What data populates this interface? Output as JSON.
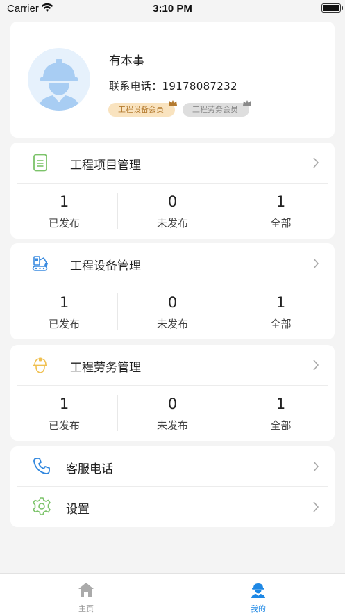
{
  "status_bar": {
    "carrier": "Carrier",
    "time": "3:10 PM"
  },
  "profile": {
    "name": "有本事",
    "phone_label": "联系电话：",
    "phone": "19178087232",
    "badges": [
      "工程设备会员",
      "工程劳务会员"
    ]
  },
  "sections": [
    {
      "title": "工程项目管理",
      "icon": "document-icon",
      "stats": [
        {
          "value": "1",
          "label": "已发布"
        },
        {
          "value": "0",
          "label": "未发布"
        },
        {
          "value": "1",
          "label": "全部"
        }
      ]
    },
    {
      "title": "工程设备管理",
      "icon": "excavator-icon",
      "stats": [
        {
          "value": "1",
          "label": "已发布"
        },
        {
          "value": "0",
          "label": "未发布"
        },
        {
          "value": "1",
          "label": "全部"
        }
      ]
    },
    {
      "title": "工程劳务管理",
      "icon": "helmet-icon",
      "stats": [
        {
          "value": "1",
          "label": "已发布"
        },
        {
          "value": "0",
          "label": "未发布"
        },
        {
          "value": "1",
          "label": "全部"
        }
      ]
    }
  ],
  "menu": [
    {
      "label": "客服电话",
      "icon": "phone-icon"
    },
    {
      "label": "设置",
      "icon": "gear-icon"
    }
  ],
  "tabbar": {
    "home": {
      "label": "主页",
      "icon": "home-icon"
    },
    "mine": {
      "label": "我的",
      "icon": "worker-icon"
    }
  },
  "colors": {
    "accent": "#1e88e5",
    "gold_badge": "#f9e3bf",
    "gray_badge": "#dedede",
    "green_icon": "#7cc36a"
  }
}
